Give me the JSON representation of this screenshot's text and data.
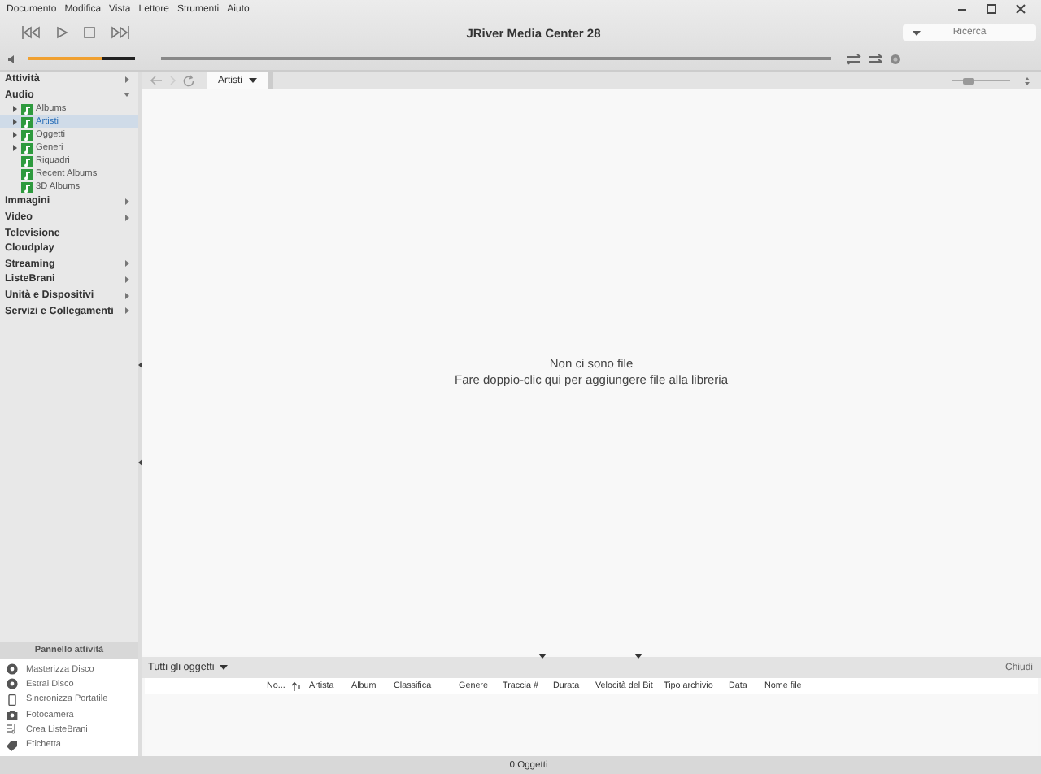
{
  "menu": [
    "Documento",
    "Modifica",
    "Vista",
    "Lettore",
    "Strumenti",
    "Aiuto"
  ],
  "window": {
    "title": "JRiver Media Center 28"
  },
  "search": {
    "placeholder": "Ricerca"
  },
  "player": {
    "volume": {
      "level": 0.7
    },
    "position": {
      "level": 0
    }
  },
  "sidebar": {
    "items": [
      {
        "label": "Attività",
        "expanded": false
      },
      {
        "label": "Audio",
        "expanded": true,
        "children": [
          {
            "label": "Albums",
            "expanded": false,
            "selected": false
          },
          {
            "label": "Artisti",
            "expanded": false,
            "selected": true
          },
          {
            "label": "Oggetti",
            "expanded": false,
            "selected": false
          },
          {
            "label": "Generi",
            "expanded": false,
            "selected": false
          },
          {
            "label": "Riquadri",
            "selected": false
          },
          {
            "label": "Recent Albums",
            "selected": false
          },
          {
            "label": "3D Albums",
            "selected": false
          }
        ]
      },
      {
        "label": "Immagini",
        "expanded": false
      },
      {
        "label": "Video",
        "expanded": false
      },
      {
        "label": "Televisione"
      },
      {
        "label": "Cloudplay"
      },
      {
        "label": "Streaming",
        "expanded": false
      },
      {
        "label": "ListeBrani",
        "expanded": false
      },
      {
        "label": "Unità e Dispositivi",
        "expanded": false
      },
      {
        "label": "Servizi e Collegamenti",
        "expanded": false
      }
    ]
  },
  "action_panel": {
    "title": "Pannello attività",
    "items": [
      {
        "label": "Masterizza Disco",
        "kind": "disc"
      },
      {
        "label": "Estrai Disco",
        "kind": "disc"
      },
      {
        "label": "Sincronizza Portatile",
        "kind": "phone"
      },
      {
        "label": "Fotocamera",
        "kind": "camera"
      },
      {
        "label": "Crea ListeBrani",
        "kind": "playlist"
      },
      {
        "label": "Etichetta",
        "kind": "tag"
      }
    ]
  },
  "view_tab": {
    "label": "Artisti"
  },
  "zoom_slider": {
    "level": 0.2
  },
  "empty_message": {
    "title": "Non ci sono file",
    "hint": "Fare doppio-clic qui per aggiungere file alla libreria"
  },
  "file_list": {
    "view": "Tutti gli oggetti",
    "close": "Chiudi",
    "columns": [
      {
        "label": "No...",
        "sorted": true
      },
      {
        "label": "Artista",
        "sorted": false
      },
      {
        "label": "Album",
        "sorted": false
      },
      {
        "label": "Classifica",
        "sorted": false
      },
      {
        "label": "Genere",
        "sorted": false
      },
      {
        "label": "Traccia #",
        "sorted": false
      },
      {
        "label": "Durata",
        "sorted": false
      },
      {
        "label": "Velocità del Bit",
        "sorted": false
      },
      {
        "label": "Tipo archivio",
        "sorted": false
      },
      {
        "label": "Data",
        "sorted": false
      },
      {
        "label": "Nome file",
        "sorted": false
      }
    ]
  },
  "status_bar": {
    "text": "0 Oggetti"
  }
}
